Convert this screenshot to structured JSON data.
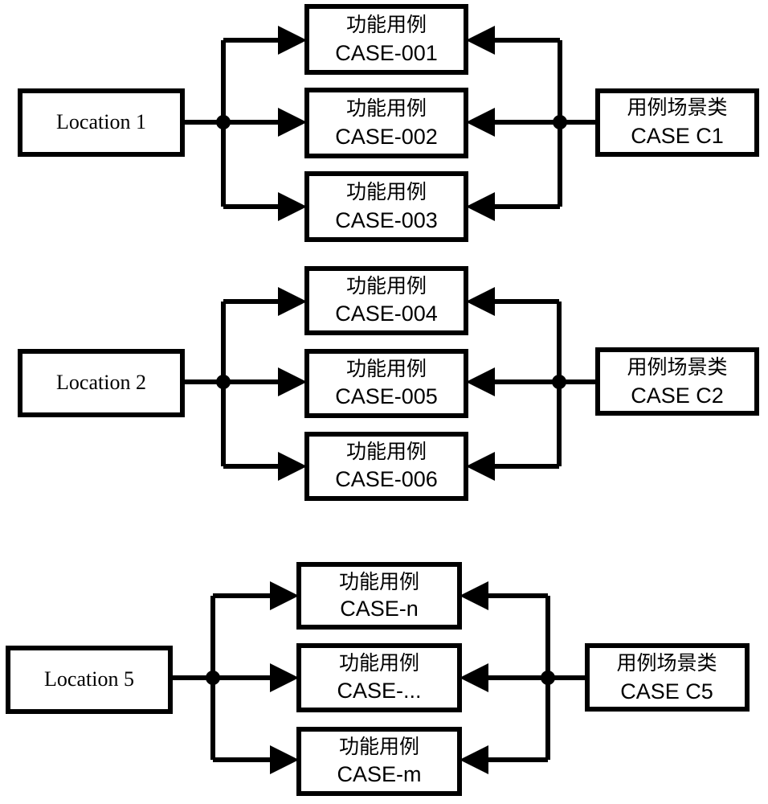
{
  "diagram": {
    "type": "flow-diagram",
    "title": "",
    "background_color": "#ffffff",
    "line_color": "#000000",
    "box_fill_color": "#ffffff",
    "groups": [
      {
        "id": "group-1",
        "source": {
          "label": "Location 1"
        },
        "cases": [
          {
            "line1": "功能用例",
            "line2": "CASE-001"
          },
          {
            "line1": "功能用例",
            "line2": "CASE-002"
          },
          {
            "line1": "功能用例",
            "line2": "CASE-003"
          }
        ],
        "scenario": {
          "line1": "用例场景类",
          "line2": "CASE C1"
        }
      },
      {
        "id": "group-2",
        "source": {
          "label": "Location 2"
        },
        "cases": [
          {
            "line1": "功能用例",
            "line2": "CASE-004"
          },
          {
            "line1": "功能用例",
            "line2": "CASE-005"
          },
          {
            "line1": "功能用例",
            "line2": "CASE-006"
          }
        ],
        "scenario": {
          "line1": "用例场景类",
          "line2": "CASE C2"
        }
      },
      {
        "id": "group-3",
        "source": {
          "label": "Location 5"
        },
        "cases": [
          {
            "line1": "功能用例",
            "line2": "CASE-n"
          },
          {
            "line1": "功能用例",
            "line2": "CASE-..."
          },
          {
            "line1": "功能用例",
            "line2": "CASE-m"
          }
        ],
        "scenario": {
          "line1": "用例场景类",
          "line2": "CASE C5"
        }
      }
    ]
  }
}
